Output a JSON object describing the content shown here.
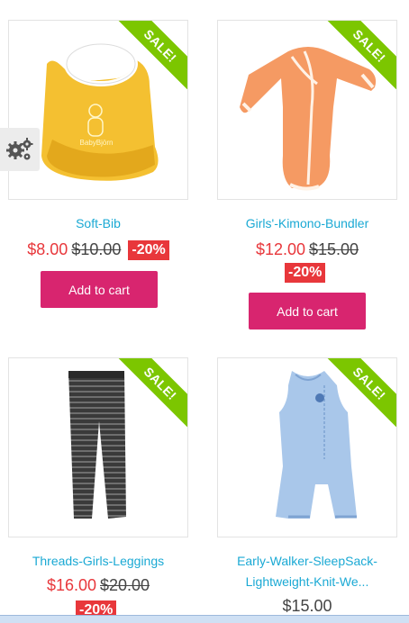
{
  "products": [
    {
      "title": "Soft-Bib",
      "price_new": "$8.00",
      "price_old": "$10.00",
      "discount": "-20%",
      "badge": "SALE!",
      "button": "Add to cart",
      "image_icon": "yellow-bib-image"
    },
    {
      "title": "Girls'-Kimono-Bundler",
      "price_new": "$12.00",
      "price_old": "$15.00",
      "discount": "-20%",
      "badge": "SALE!",
      "button": "Add to cart",
      "image_icon": "orange-kimono-image"
    },
    {
      "title": "Threads-Girls-Leggings",
      "price_new": "$16.00",
      "price_old": "$20.00",
      "discount": "-20%",
      "badge": "SALE!",
      "image_icon": "striped-leggings-image"
    },
    {
      "title_line1": "Early-Walker-SleepSack-",
      "title_line2": "Lightweight-Knit-We...",
      "price": "$15.00",
      "badge": "SALE!",
      "image_icon": "blue-sleepsack-image"
    }
  ],
  "settings": {
    "icon": "gears-icon"
  },
  "colors": {
    "sale_green": "#7cc600",
    "price_red": "#e8373b",
    "title_blue": "#1aa9d4",
    "button_pink": "#d8256f"
  }
}
